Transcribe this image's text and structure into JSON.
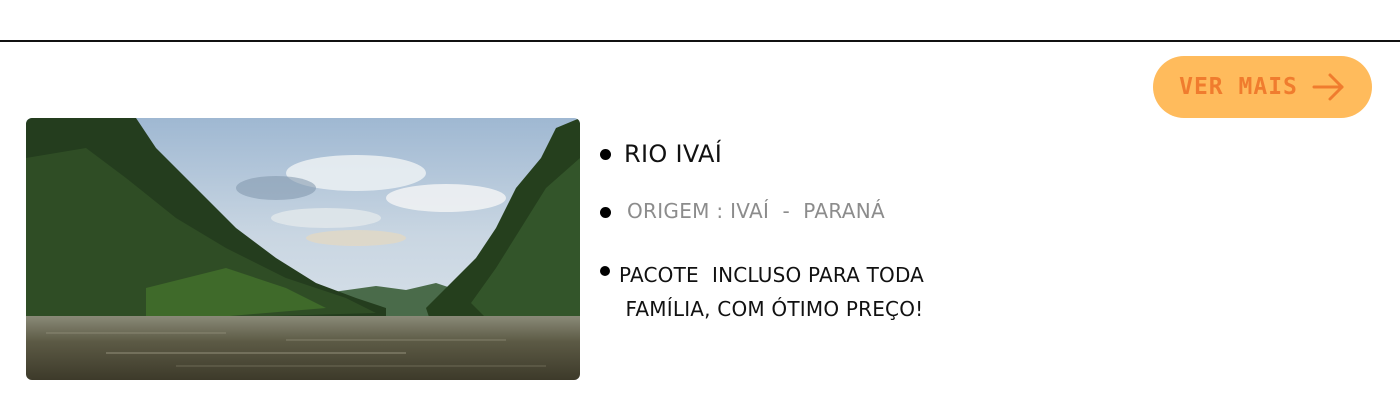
{
  "button": {
    "label": "VER MAIS",
    "background_color": "#ffbb5c",
    "text_color": "#f07c2e",
    "icon": "arrow-right-icon"
  },
  "card": {
    "image_alt": "river-landscape-photo",
    "title": "RIO IVAÍ",
    "origin": "ORIGEM : IVAÍ  -  PARANÁ",
    "description_line1": "PACOTE  INCLUSO PARA TODA",
    "description_line2": " FAMÍLIA, COM ÓTIMO PREÇO!"
  }
}
